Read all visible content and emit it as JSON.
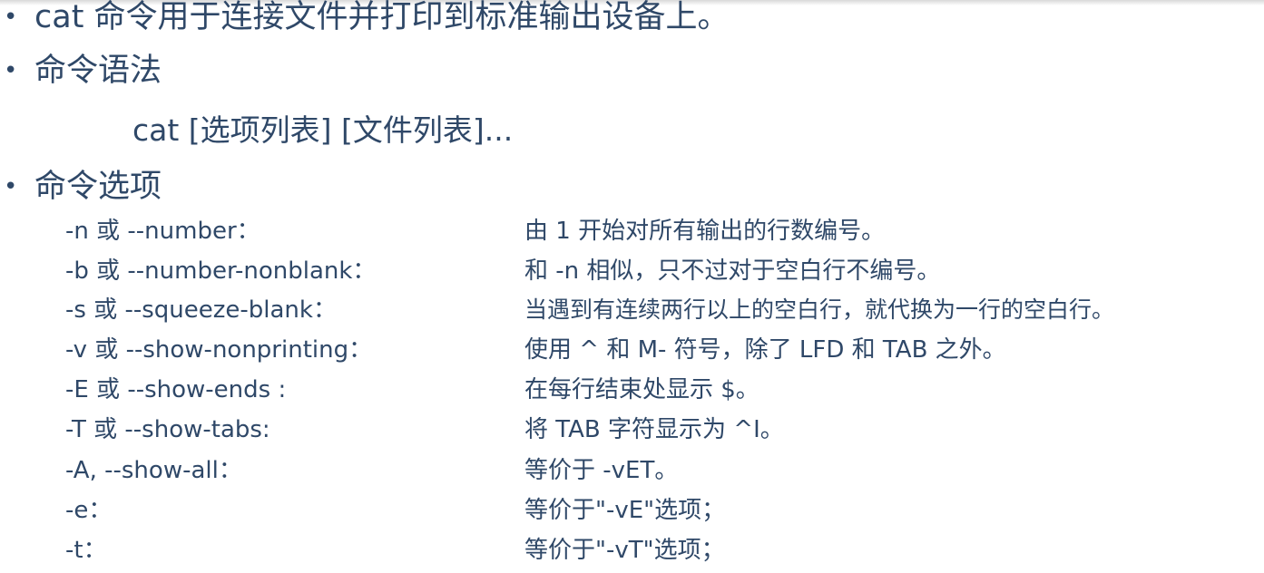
{
  "intro": "cat 命令用于连接文件并打印到标准输出设备上。",
  "syntax_heading": "命令语法",
  "syntax_line": "cat [选项列表] [文件列表]...",
  "options_heading": "命令选项",
  "bullet_symbol": "•",
  "options": [
    {
      "name": "-n 或 --number：",
      "desc": "由 1 开始对所有输出的行数编号。"
    },
    {
      "name": "-b 或 --number-nonblank：",
      "desc": "和 -n 相似，只不过对于空白行不编号。"
    },
    {
      "name": "-s 或 --squeeze-blank：",
      "desc": "当遇到有连续两行以上的空白行，就代换为一行的空白行。"
    },
    {
      "name": "-v 或 --show-nonprinting：",
      "desc": "使用 ^ 和 M- 符号，除了 LFD 和 TAB 之外。"
    },
    {
      "name": "-E 或 --show-ends :",
      "desc": "在每行结束处显示 $。"
    },
    {
      "name": "-T 或 --show-tabs:",
      "desc": "将 TAB 字符显示为 ^I。"
    },
    {
      "name": "-A, --show-all：",
      "desc": "等价于 -vET。"
    },
    {
      "name": "-e：",
      "desc": "等价于\"-vE\"选项；"
    },
    {
      "name": "-t：",
      "desc": "等价于\"-vT\"选项；"
    }
  ]
}
